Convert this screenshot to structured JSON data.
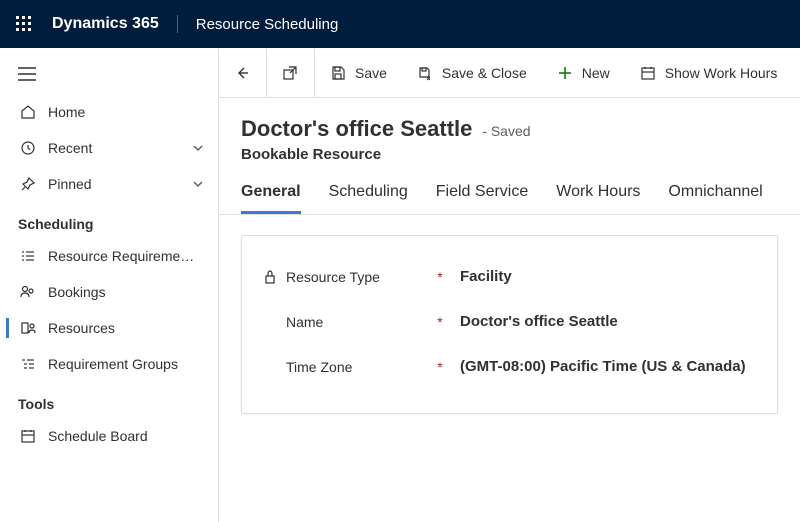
{
  "header": {
    "brand": "Dynamics 365",
    "module": "Resource Scheduling"
  },
  "nav": {
    "home": "Home",
    "recent": "Recent",
    "pinned": "Pinned",
    "group_scheduling": "Scheduling",
    "resource_requirements": "Resource Requireme…",
    "bookings": "Bookings",
    "resources": "Resources",
    "requirement_groups": "Requirement Groups",
    "group_tools": "Tools",
    "schedule_board": "Schedule Board"
  },
  "commands": {
    "save": "Save",
    "save_close": "Save & Close",
    "new": "New",
    "show_work_hours": "Show Work Hours"
  },
  "record": {
    "title": "Doctor's office Seattle",
    "status": "- Saved",
    "entity": "Bookable Resource"
  },
  "tabs": {
    "general": "General",
    "scheduling": "Scheduling",
    "field_service": "Field Service",
    "work_hours": "Work Hours",
    "omnichannel": "Omnichannel"
  },
  "form": {
    "resource_type_label": "Resource Type",
    "resource_type_value": "Facility",
    "name_label": "Name",
    "name_value": "Doctor's office Seattle",
    "timezone_label": "Time Zone",
    "timezone_value": "(GMT-08:00) Pacific Time (US & Canada)",
    "required_marker": "*"
  }
}
